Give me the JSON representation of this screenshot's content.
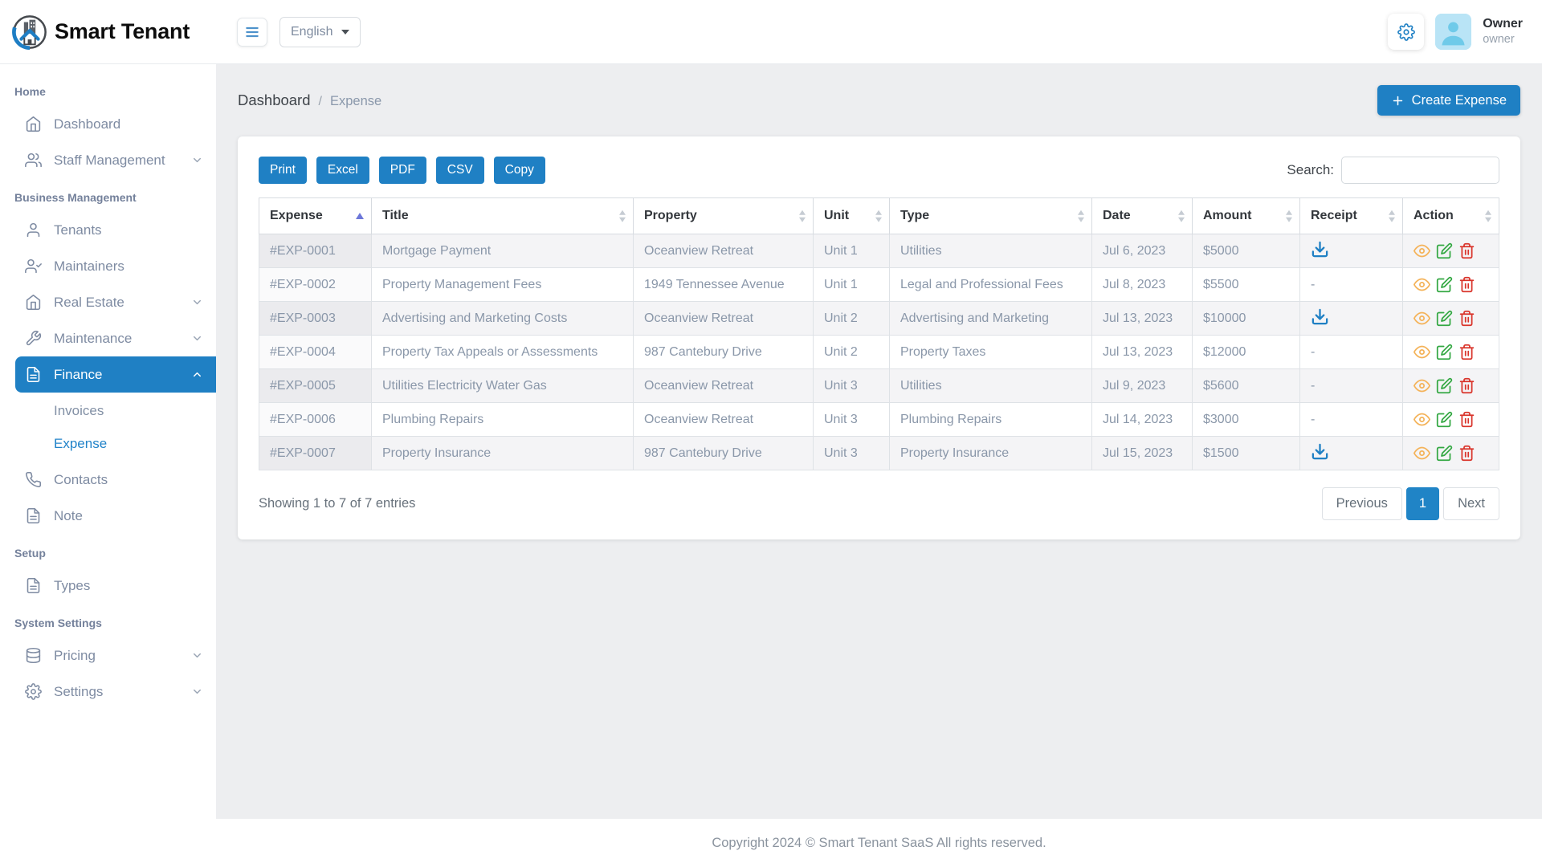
{
  "brand": {
    "name": "Smart Tenant"
  },
  "topbar": {
    "language": "English",
    "user_name": "Owner",
    "user_role": "owner"
  },
  "breadcrumb": {
    "root": "Dashboard",
    "current": "Expense"
  },
  "page": {
    "create_expense": "Create Expense"
  },
  "sidebar": {
    "sections": [
      {
        "label": "Home",
        "items": [
          {
            "label": "Dashboard",
            "icon": "home"
          },
          {
            "label": "Staff Management",
            "icon": "users",
            "expandable": true
          }
        ]
      },
      {
        "label": "Business Management",
        "items": [
          {
            "label": "Tenants",
            "icon": "user"
          },
          {
            "label": "Maintainers",
            "icon": "user-check"
          },
          {
            "label": "Real Estate",
            "icon": "home",
            "expandable": true
          },
          {
            "label": "Maintenance",
            "icon": "wrench",
            "expandable": true
          },
          {
            "label": "Finance",
            "icon": "file",
            "expandable": true,
            "expanded": true,
            "active": true,
            "children": [
              {
                "label": "Invoices"
              },
              {
                "label": "Expense",
                "active": true
              }
            ]
          },
          {
            "label": "Contacts",
            "icon": "phone"
          },
          {
            "label": "Note",
            "icon": "file"
          }
        ]
      },
      {
        "label": "Setup",
        "items": [
          {
            "label": "Types",
            "icon": "file"
          }
        ]
      },
      {
        "label": "System Settings",
        "items": [
          {
            "label": "Pricing",
            "icon": "database",
            "expandable": true
          },
          {
            "label": "Settings",
            "icon": "gear",
            "expandable": true
          }
        ]
      }
    ]
  },
  "toolbar": {
    "export_buttons": [
      "Print",
      "Excel",
      "PDF",
      "CSV",
      "Copy"
    ],
    "search_label": "Search:",
    "search_value": ""
  },
  "table": {
    "columns": [
      "Expense",
      "Title",
      "Property",
      "Unit",
      "Type",
      "Date",
      "Amount",
      "Receipt",
      "Action"
    ],
    "sorted_column": "Expense",
    "sort_direction": "asc",
    "rows": [
      {
        "expense": "#EXP-0001",
        "title": "Mortgage Payment",
        "property": "Oceanview Retreat",
        "unit": "Unit 1",
        "type": "Utilities",
        "date": "Jul 6, 2023",
        "amount": "$5000",
        "receipt": "download"
      },
      {
        "expense": "#EXP-0002",
        "title": "Property Management Fees",
        "property": "1949 Tennessee Avenue",
        "unit": "Unit 1",
        "type": "Legal and Professional Fees",
        "date": "Jul 8, 2023",
        "amount": "$5500",
        "receipt": "-"
      },
      {
        "expense": "#EXP-0003",
        "title": "Advertising and Marketing Costs",
        "property": "Oceanview Retreat",
        "unit": "Unit 2",
        "type": "Advertising and Marketing",
        "date": "Jul 13, 2023",
        "amount": "$10000",
        "receipt": "download"
      },
      {
        "expense": "#EXP-0004",
        "title": "Property Tax Appeals or Assessments",
        "property": "987 Cantebury Drive",
        "unit": "Unit 2",
        "type": "Property Taxes",
        "date": "Jul 13, 2023",
        "amount": "$12000",
        "receipt": "-"
      },
      {
        "expense": "#EXP-0005",
        "title": "Utilities Electricity Water Gas",
        "property": "Oceanview Retreat",
        "unit": "Unit 3",
        "type": "Utilities",
        "date": "Jul 9, 2023",
        "amount": "$5600",
        "receipt": "-"
      },
      {
        "expense": "#EXP-0006",
        "title": "Plumbing Repairs",
        "property": "Oceanview Retreat",
        "unit": "Unit 3",
        "type": "Plumbing Repairs",
        "date": "Jul 14, 2023",
        "amount": "$3000",
        "receipt": "-"
      },
      {
        "expense": "#EXP-0007",
        "title": "Property Insurance",
        "property": "987 Cantebury Drive",
        "unit": "Unit 3",
        "type": "Property Insurance",
        "date": "Jul 15, 2023",
        "amount": "$1500",
        "receipt": "download"
      }
    ]
  },
  "pagination": {
    "info": "Showing 1 to 7 of 7 entries",
    "previous": "Previous",
    "current_page": "1",
    "next": "Next"
  },
  "footer": {
    "copyright": "Copyright 2024 © Smart Tenant SaaS All rights reserved."
  },
  "colors": {
    "accent": "#1f80c4",
    "view_icon": "#f4b35a",
    "edit_icon": "#34a843",
    "delete_icon": "#d9342b",
    "download_icon": "#1f80c4",
    "sort_active": "#6d77d9",
    "active_page_bg": "#2084c6"
  }
}
